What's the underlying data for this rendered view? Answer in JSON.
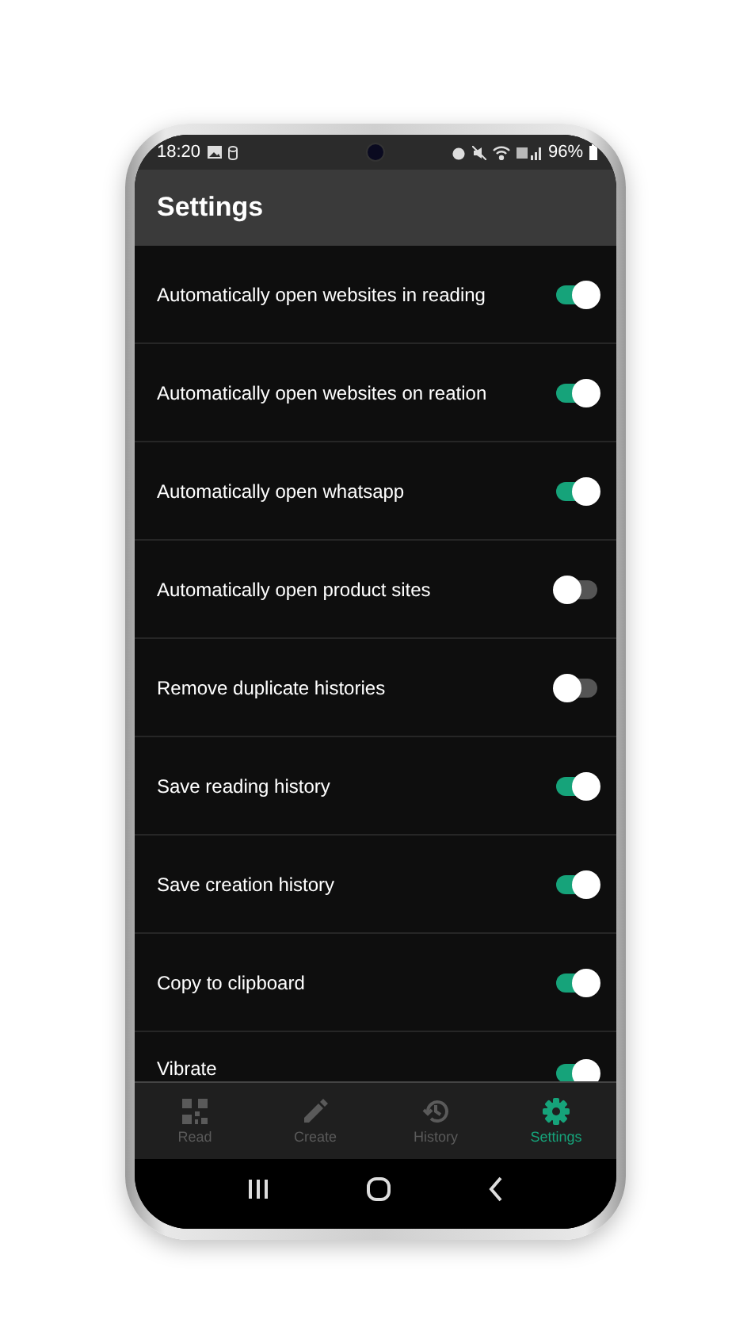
{
  "status_bar": {
    "time": "18:20",
    "battery": "96%"
  },
  "app_bar": {
    "title": "Settings"
  },
  "settings": [
    {
      "label": "Automatically open websites in reading",
      "on": true
    },
    {
      "label": "Automatically open websites on reation",
      "on": true
    },
    {
      "label": "Automatically open whatsapp",
      "on": true
    },
    {
      "label": "Automatically open product sites",
      "on": false
    },
    {
      "label": "Remove duplicate histories",
      "on": false
    },
    {
      "label": "Save reading history",
      "on": true
    },
    {
      "label": "Save creation history",
      "on": true
    },
    {
      "label": "Copy to clipboard",
      "on": true
    },
    {
      "label": "Vibrate",
      "on": true
    }
  ],
  "bottom_nav": [
    {
      "kind": "read",
      "label": "Read",
      "selected": false
    },
    {
      "kind": "create",
      "label": "Create",
      "selected": false
    },
    {
      "kind": "history",
      "label": "History",
      "selected": false
    },
    {
      "kind": "settings",
      "label": "Settings",
      "selected": true
    }
  ]
}
